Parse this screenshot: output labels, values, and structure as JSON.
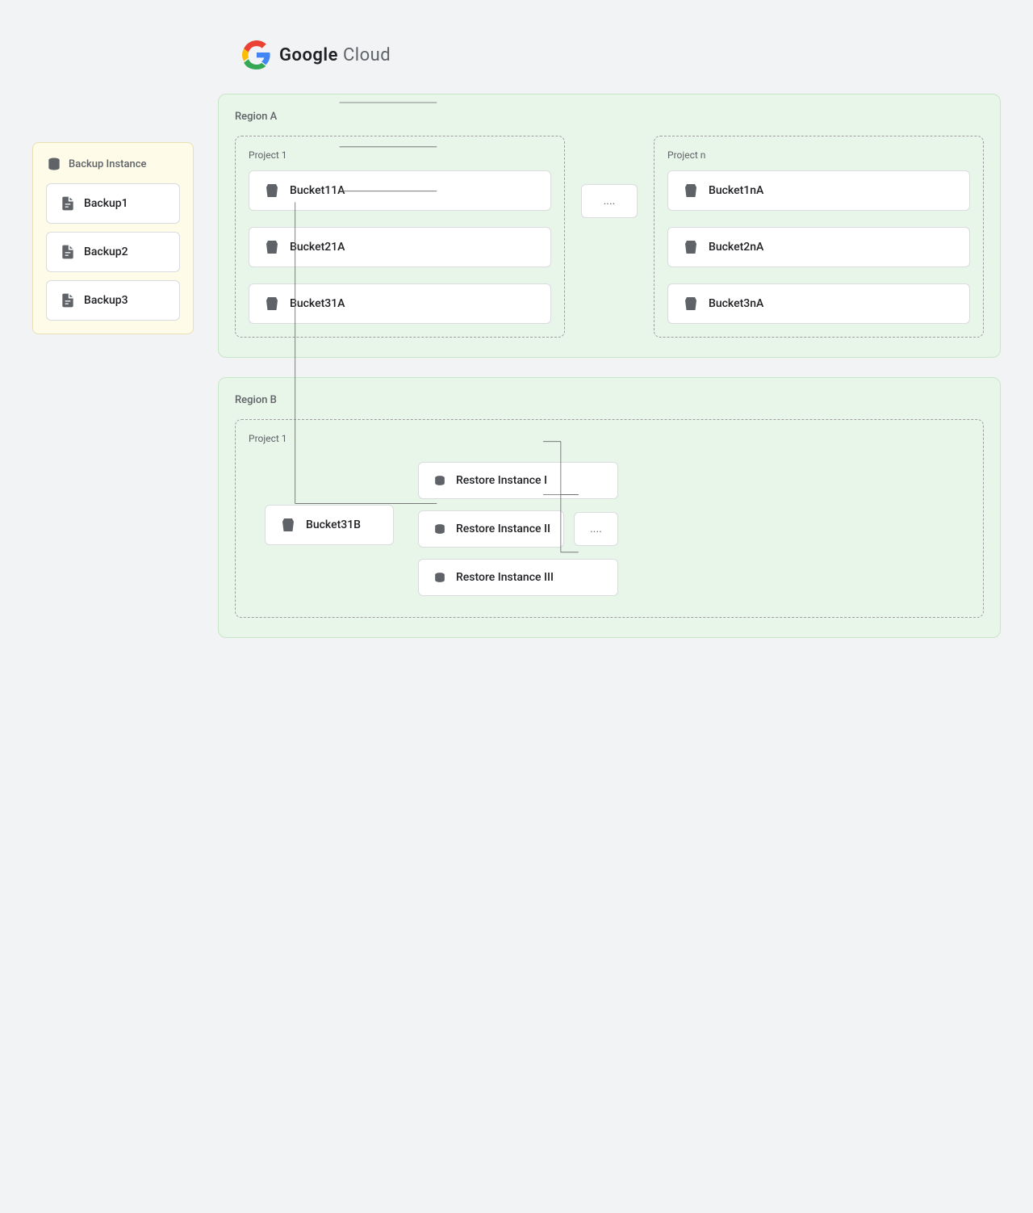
{
  "logo": {
    "alt": "Google Cloud",
    "text_google": "Google",
    "text_cloud": "Cloud"
  },
  "backup_panel": {
    "title": "Backup Instance",
    "items": [
      {
        "id": "backup1",
        "label": "Backup1"
      },
      {
        "id": "backup2",
        "label": "Backup2"
      },
      {
        "id": "backup3",
        "label": "Backup3"
      }
    ]
  },
  "regions": [
    {
      "id": "region_a",
      "label": "Region A",
      "projects": [
        {
          "id": "project1",
          "label": "Project 1",
          "buckets": [
            {
              "id": "bucket11a",
              "label": "Bucket11A"
            },
            {
              "id": "bucket21a",
              "label": "Bucket21A"
            },
            {
              "id": "bucket31a",
              "label": "Bucket31A"
            }
          ]
        },
        {
          "id": "ellipsis_col",
          "ellipsis": "...."
        },
        {
          "id": "projectn",
          "label": "Project n",
          "buckets": [
            {
              "id": "bucket1na",
              "label": "Bucket1nA"
            },
            {
              "id": "bucket2na",
              "label": "Bucket2nA"
            },
            {
              "id": "bucket3na",
              "label": "Bucket3nA"
            }
          ]
        }
      ]
    },
    {
      "id": "region_b",
      "label": "Region B",
      "projects": [
        {
          "id": "project1b",
          "label": "Project 1",
          "bucket": {
            "id": "bucket31b",
            "label": "Bucket31B"
          },
          "restore_instances": [
            {
              "id": "restore_i",
              "label": "Restore Instance I"
            },
            {
              "id": "restore_ii",
              "label": "Restore Instance II"
            },
            {
              "id": "restore_iii",
              "label": "Restore Instance III"
            }
          ],
          "ellipsis": "...."
        }
      ]
    }
  ],
  "ellipsis": "...."
}
